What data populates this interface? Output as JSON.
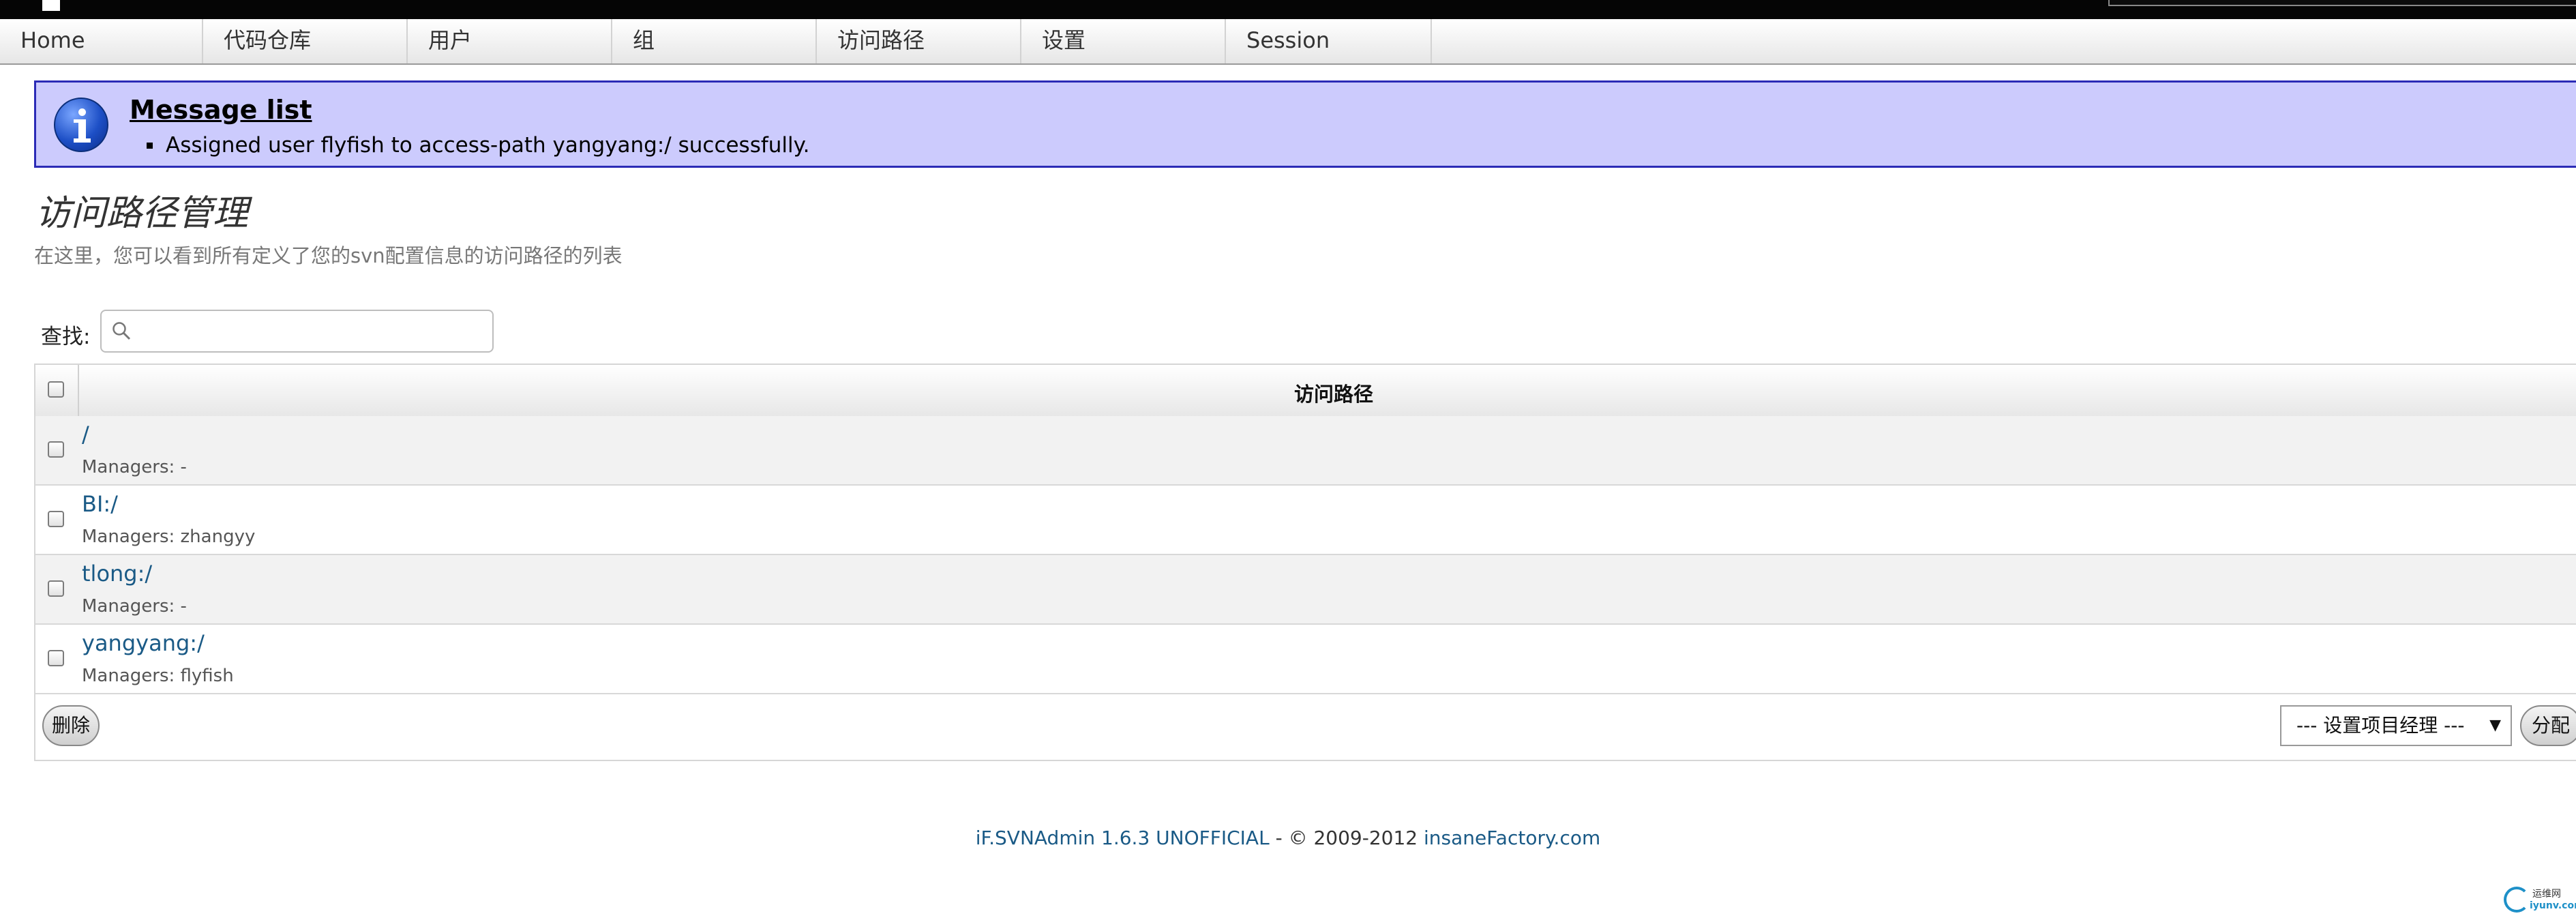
{
  "nav": {
    "items": [
      {
        "label": "Home"
      },
      {
        "label": "代码仓库"
      },
      {
        "label": "用户"
      },
      {
        "label": "组"
      },
      {
        "label": "访问路径"
      },
      {
        "label": "设置"
      },
      {
        "label": "Session"
      }
    ]
  },
  "message": {
    "title": "Message list",
    "items": [
      "Assigned user flyfish to access-path yangyang:/ successfully."
    ],
    "icon": "info-icon"
  },
  "page": {
    "title": "访问路径管理",
    "description": "在这里，您可以看到所有定义了您的svn配置信息的访问路径的列表"
  },
  "search": {
    "label": "查找:",
    "value": ""
  },
  "table": {
    "header": "访问路径",
    "rows": [
      {
        "path": "/",
        "managers": "Managers: -"
      },
      {
        "path": "BI:/",
        "managers": "Managers: zhangyy"
      },
      {
        "path": "tlong:/",
        "managers": "Managers: -"
      },
      {
        "path": "yangyang:/",
        "managers": "Managers: flyfish"
      }
    ],
    "delete_label": "删除",
    "manager_select": "--- 设置项目经理 ---",
    "assign_label": "分配"
  },
  "footer": {
    "product": "iF.SVNAdmin 1.6.3 UNOFFICIAL",
    "copyright": " - © 2009-2012 ",
    "company": "insaneFactory.com"
  },
  "watermark": {
    "line1": "运维网",
    "line2": "iyunv.com"
  },
  "colors": {
    "message_bg": "#cccbfd",
    "message_border": "#2b2bb6",
    "link": "#1a5a86"
  }
}
